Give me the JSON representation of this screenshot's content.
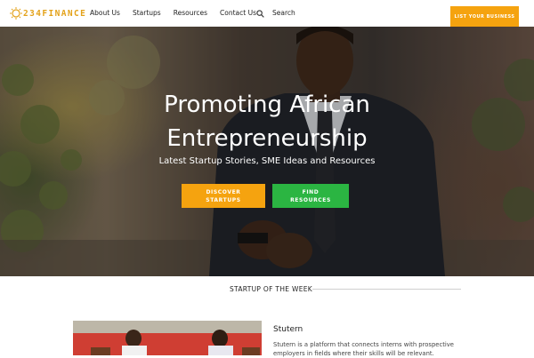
{
  "header": {
    "logo_text": "234FINANCE",
    "nav": [
      "About Us",
      "Startups",
      "Resources",
      "Contact Us"
    ],
    "search_label": "Search",
    "cta_label": "LIST YOUR BUSINESS",
    "accent_color": "#f5a30f"
  },
  "hero": {
    "title_line1": "Promoting African",
    "title_line2": "Entrepreneurship",
    "subtitle": "Latest Startup Stories, SME Ideas and Resources",
    "btn_discover": "DISCOVER STARTUPS",
    "btn_find": "FIND RESOURCES",
    "btn_discover_color": "#f5a30f",
    "btn_find_color": "#2bb542"
  },
  "section": {
    "title": "STARTUP OF THE WEEK",
    "card_title": "Stutern",
    "card_desc": "Stutern is a platform that connects interns with prospective employers in fields where their skills will be relevant."
  }
}
